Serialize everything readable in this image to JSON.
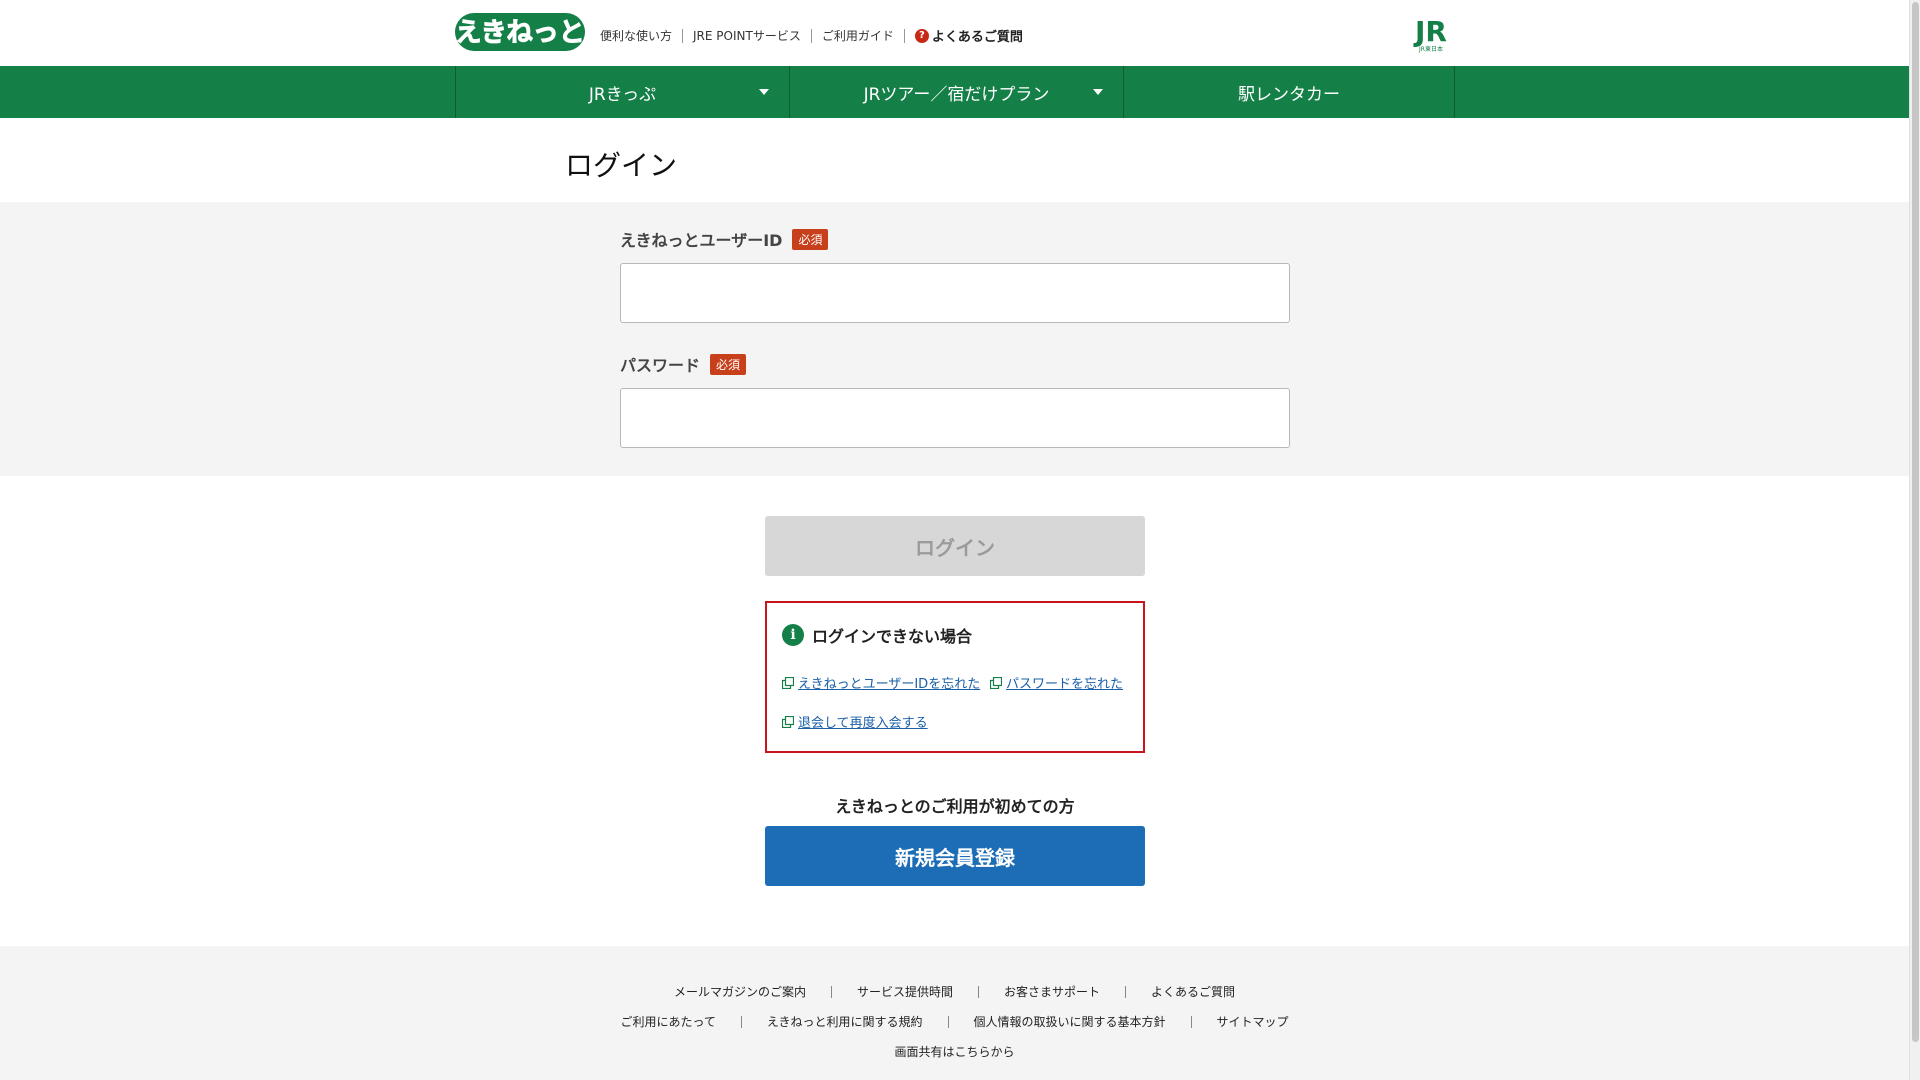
{
  "header": {
    "logo_text": "えきねっと",
    "links": [
      "便利な使い方",
      "JRE POINTサービス",
      "ご利用ガイド"
    ],
    "faq_label": "よくあるご質問",
    "jr_logo_text": "JR",
    "jr_logo_sub": "JR東日本"
  },
  "nav": {
    "items": [
      {
        "label": "JRきっぷ"
      },
      {
        "label": "JRツアー／宿だけプラン"
      },
      {
        "label": "駅レンタカー"
      }
    ]
  },
  "page": {
    "title": "ログイン"
  },
  "form": {
    "user_id_label": "えきねっとユーザーID",
    "password_label": "パスワード",
    "required_badge": "必須",
    "user_id_value": "",
    "password_value": ""
  },
  "login_button": "ログイン",
  "help": {
    "heading": "ログインできない場合",
    "links": [
      "えきねっとユーザーIDを忘れた",
      "パスワードを忘れた",
      "退会して再度入会する"
    ]
  },
  "register": {
    "prompt": "えきねっとのご利用が初めての方",
    "button": "新規会員登録"
  },
  "footer": {
    "row1": [
      "メールマガジンのご案内",
      "サービス提供時間",
      "お客さまサポート",
      "よくあるご質問"
    ],
    "row2": [
      "ご利用にあたって",
      "えきねっと利用に関する規約",
      "個人情報の取扱いに関する基本方針",
      "サイトマップ"
    ],
    "row3": [
      "画面共有はこちらから"
    ]
  },
  "colors": {
    "brand_green": "#148047",
    "required_red": "#c8401b",
    "help_border": "#c8141c",
    "register_blue": "#1c6db5",
    "link_blue": "#1a5fa8"
  }
}
